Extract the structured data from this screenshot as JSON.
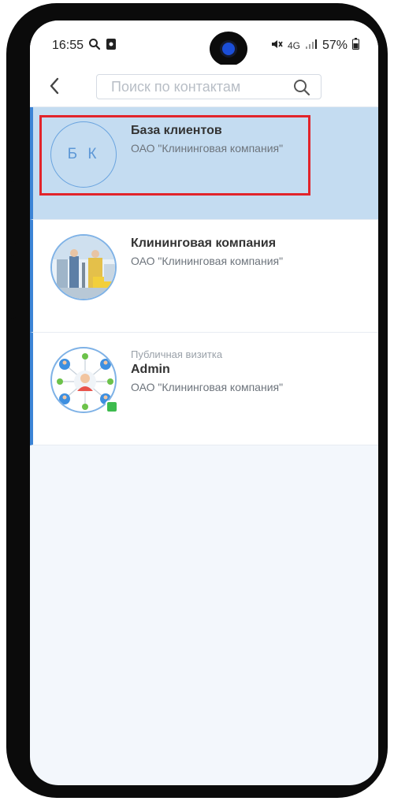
{
  "status_bar": {
    "time": "16:55",
    "network": "4G",
    "battery": "57%"
  },
  "top_bar": {
    "search_placeholder": "Поиск по контактам"
  },
  "contacts": [
    {
      "label": "",
      "name": "База клиентов",
      "org": "ОАО \"Клининговая компания\"",
      "initials": "Б К",
      "selected": true
    },
    {
      "label": "",
      "name": "Клининговая компания",
      "org": "ОАО \"Клининговая компания\"",
      "initials": "",
      "selected": false
    },
    {
      "label": "Публичная визитка",
      "name": "Admin",
      "org": "ОАО \"Клининговая компания\"",
      "initials": "",
      "selected": false
    }
  ],
  "colors": {
    "accent": "#3c84d6",
    "selected_bg": "#c4dcf1",
    "highlight": "#e2242b",
    "online": "#3dbb4e"
  }
}
